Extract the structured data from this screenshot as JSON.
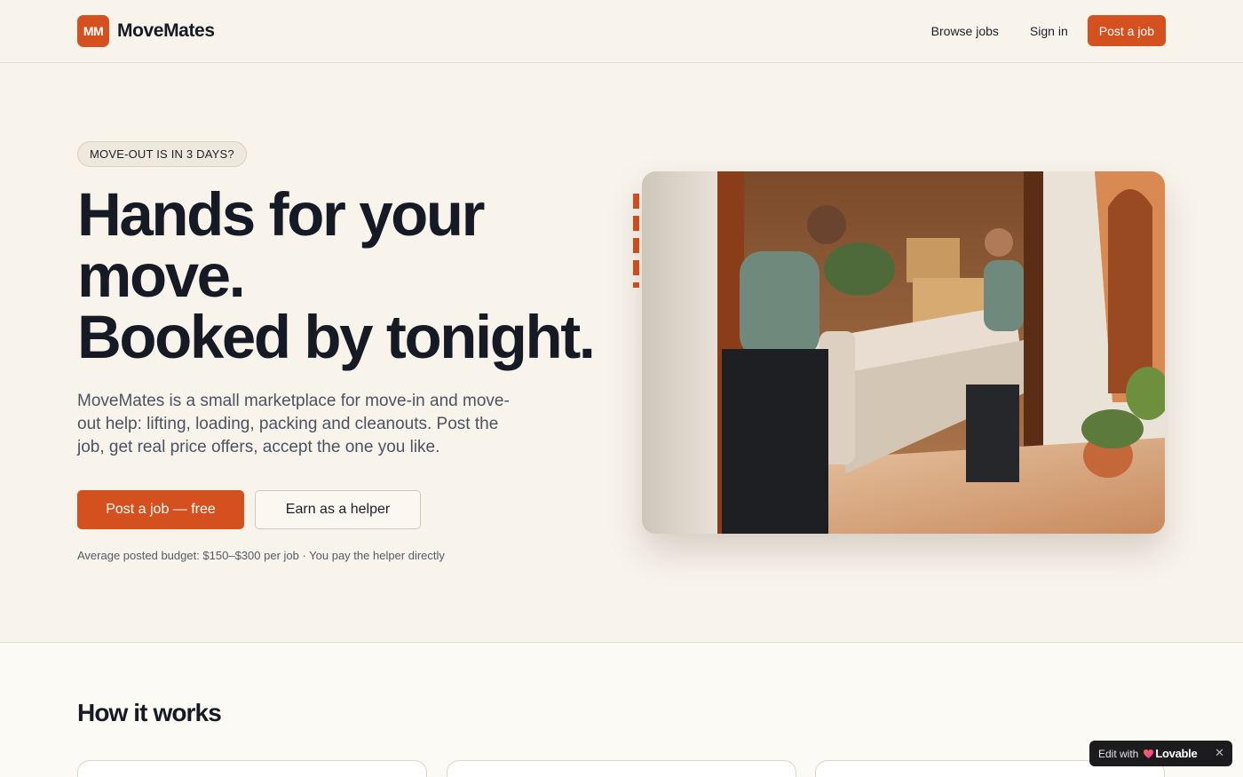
{
  "header": {
    "brand_initials": "MM",
    "brand_name": "MoveMates",
    "nav": {
      "browse_jobs": "Browse jobs",
      "sign_in": "Sign in",
      "post_job": "Post a job"
    }
  },
  "hero": {
    "pill": "MOVE-OUT IS IN 3 DAYS?",
    "title_lines": [
      "Hands for your",
      "move.",
      "Booked by tonight."
    ],
    "description": "MoveMates is a small marketplace for move-in and move-out help: lifting, loading, packing and cleanouts. Post the job, get real price offers, accept the one you like.",
    "primary_cta": "Post a job — free",
    "secondary_cta": "Earn as a helper",
    "note": "Average posted budget: $150–$300 per job · You pay the helper directly",
    "image_icon": "movers-carrying-sofa-photo"
  },
  "how_it_works": {
    "title": "How it works"
  },
  "lovable_badge": {
    "edit_label": "Edit with",
    "brand": "Lovable",
    "close": "✕"
  },
  "colors": {
    "accent": "#d4511f",
    "background": "#f8f4ec",
    "text": "#151a24"
  }
}
